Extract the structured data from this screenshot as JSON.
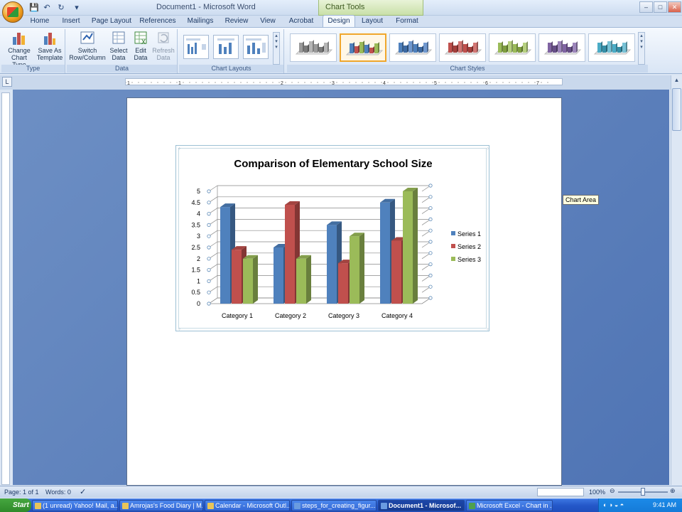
{
  "app": {
    "window_title": "Document1 - Microsoft Word",
    "context_tab_group": "Chart Tools"
  },
  "tabs": [
    {
      "label": "Home"
    },
    {
      "label": "Insert"
    },
    {
      "label": "Page Layout"
    },
    {
      "label": "References"
    },
    {
      "label": "Mailings"
    },
    {
      "label": "Review"
    },
    {
      "label": "View"
    },
    {
      "label": "Acrobat"
    },
    {
      "label": "Design"
    },
    {
      "label": "Layout"
    },
    {
      "label": "Format"
    }
  ],
  "ribbon": {
    "type_group": {
      "label": "Type",
      "change_chart_type": [
        "Change",
        "Chart Type"
      ],
      "save_as_template": [
        "Save As",
        "Template"
      ]
    },
    "data_group": {
      "label": "Data",
      "switch_row_column": [
        "Switch",
        "Row/Column"
      ],
      "select_data": [
        "Select",
        "Data"
      ],
      "edit_data": [
        "Edit",
        "Data"
      ],
      "refresh_data": [
        "Refresh",
        "Data"
      ]
    },
    "chart_layouts": {
      "label": "Chart Layouts"
    },
    "chart_styles": {
      "label": "Chart Styles",
      "palettes": [
        [
          "#9a9a9a",
          "#7a7a7a",
          "#b5b5b5"
        ],
        [
          "#4f81bd",
          "#c0504d",
          "#9bbb59"
        ],
        [
          "#4f81bd",
          "#3d6aa3",
          "#7199cf"
        ],
        [
          "#c0504d",
          "#a43f3c",
          "#d27673"
        ],
        [
          "#9bbb59",
          "#7f9e40",
          "#b6d07f"
        ],
        [
          "#8064a2",
          "#674f87",
          "#9d86bb"
        ],
        [
          "#4bacc6",
          "#3690a8",
          "#78c2d6"
        ]
      ]
    }
  },
  "ruler": {
    "numbers": [
      "1",
      "1",
      "2",
      "3",
      "4",
      "5",
      "6",
      "7"
    ]
  },
  "tooltip": "Chart Area",
  "statusbar": {
    "page": "Page: 1 of 1",
    "words": "Words: 0",
    "zoom": "100%"
  },
  "taskbar": {
    "start": "Start",
    "tasks": [
      {
        "label": "(1 unread) Yahoo! Mail, a..."
      },
      {
        "label": "Amrojas's Food Diary | M..."
      },
      {
        "label": "Calendar - Microsoft Outl..."
      },
      {
        "label": "steps_for_creating_figur..."
      },
      {
        "label": "Document1 - Microsof..."
      },
      {
        "label": "Microsoft Excel - Chart in ..."
      }
    ],
    "clock": "9:41 AM"
  },
  "colors": {
    "series1": "#4f81bd",
    "series2": "#c0504d",
    "series3": "#9bbb59"
  },
  "chart_data": {
    "type": "bar",
    "title": "Comparison of Elementary School Size",
    "categories": [
      "Category 1",
      "Category 2",
      "Category 3",
      "Category 4"
    ],
    "series": [
      {
        "name": "Series 1",
        "values": [
          4.3,
          2.5,
          3.5,
          4.5
        ]
      },
      {
        "name": "Series 2",
        "values": [
          2.4,
          4.4,
          1.8,
          2.8
        ]
      },
      {
        "name": "Series 3",
        "values": [
          2,
          2,
          3,
          5
        ]
      }
    ],
    "ylim": [
      0,
      5
    ],
    "yticks": [
      "0",
      "0.5",
      "1",
      "1.5",
      "2",
      "2.5",
      "3",
      "3.5",
      "4",
      "4.5",
      "5"
    ],
    "grid": true,
    "legend": "right",
    "style": "3-D clustered column"
  }
}
